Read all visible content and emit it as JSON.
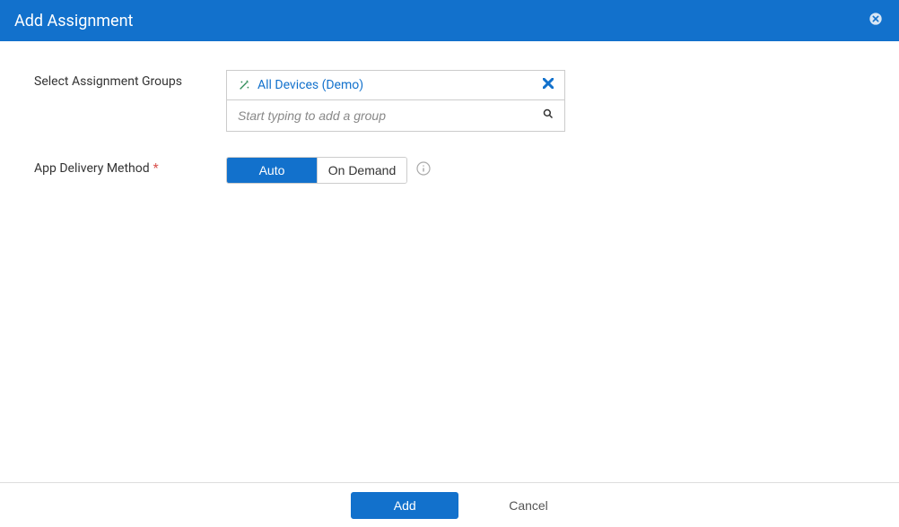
{
  "header": {
    "title": "Add Assignment"
  },
  "form": {
    "groups_label": "Select Assignment Groups",
    "selected_group": "All Devices (Demo)",
    "search_placeholder": "Start typing to add a group",
    "delivery_label": "App Delivery Method",
    "delivery_options": {
      "auto": "Auto",
      "on_demand": "On Demand"
    }
  },
  "footer": {
    "add": "Add",
    "cancel": "Cancel"
  }
}
